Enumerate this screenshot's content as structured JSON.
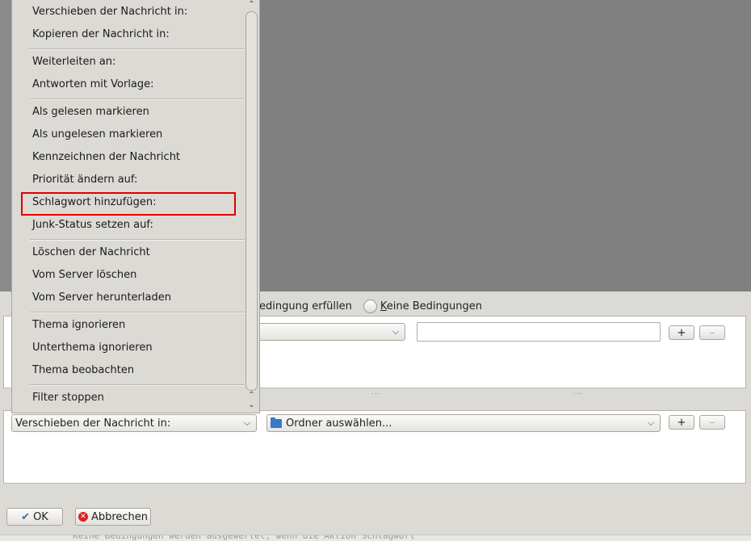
{
  "context_menu": {
    "items": [
      "Verschieben der Nachricht in:",
      "Kopieren der Nachricht in:",
      "Weiterleiten an:",
      "Antworten mit Vorlage:",
      "Als gelesen markieren",
      "Als ungelesen markieren",
      "Kennzeichnen der Nachricht",
      "Priorität ändern auf:",
      "Schlagwort hinzufügen:",
      "Junk-Status setzen auf:",
      "Löschen der Nachricht",
      "Vom Server löschen",
      "Vom Server herunterladen",
      "Thema ignorieren",
      "Unterthema ignorieren",
      "Thema beobachten",
      "Filter stoppen"
    ],
    "highlighted": "Schlagwort hinzufügen:"
  },
  "conditions": {
    "radio_partial_label": "e Bedingung erfüllen",
    "radio_none_label": "Keine Bedingungen",
    "radio_none_accesskey_letter": "K"
  },
  "actions": {
    "action_select_value": "Verschieben der Nachricht in:",
    "folder_select_value": "Ordner auswählen..."
  },
  "buttons": {
    "add": "+",
    "remove": "–",
    "ok": "OK",
    "cancel": "Abbrechen"
  },
  "bottom_text": "Keine Bedingungen werden ausgewertet, wenn die Aktion Schlagwort"
}
